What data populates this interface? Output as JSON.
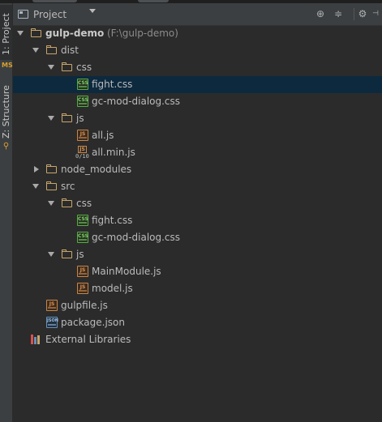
{
  "side_tabs": [
    {
      "label": "1: Project"
    },
    {
      "label": "Z: Structure"
    }
  ],
  "header": {
    "view_label": "Project",
    "buttons": [
      "target-icon",
      "collapse-icon",
      "gear-icon",
      "hide-icon"
    ]
  },
  "tree": [
    {
      "depth": 0,
      "type": "folder",
      "arrow": "down",
      "label": "gulp-demo",
      "hint": "(F:\\gulp-demo)",
      "bold": true
    },
    {
      "depth": 1,
      "type": "folder",
      "arrow": "down",
      "label": "dist"
    },
    {
      "depth": 2,
      "type": "folder",
      "arrow": "down",
      "label": "css"
    },
    {
      "depth": 3,
      "type": "css",
      "label": "fight.css",
      "selected": true
    },
    {
      "depth": 3,
      "type": "css",
      "label": "gc-mod-dialog.css"
    },
    {
      "depth": 2,
      "type": "folder",
      "arrow": "down",
      "label": "js"
    },
    {
      "depth": 3,
      "type": "js",
      "label": "all.js"
    },
    {
      "depth": 3,
      "type": "minjs",
      "label": "all.min.js"
    },
    {
      "depth": 1,
      "type": "folder",
      "arrow": "right",
      "label": "node_modules"
    },
    {
      "depth": 1,
      "type": "folder",
      "arrow": "down",
      "label": "src"
    },
    {
      "depth": 2,
      "type": "folder",
      "arrow": "down",
      "label": "css"
    },
    {
      "depth": 3,
      "type": "css",
      "label": "fight.css"
    },
    {
      "depth": 3,
      "type": "css",
      "label": "gc-mod-dialog.css"
    },
    {
      "depth": 2,
      "type": "folder",
      "arrow": "down",
      "label": "js"
    },
    {
      "depth": 3,
      "type": "js",
      "label": "MainModule.js"
    },
    {
      "depth": 3,
      "type": "js",
      "label": "model.js"
    },
    {
      "depth": 1,
      "type": "js",
      "label": "gulpfile.js"
    },
    {
      "depth": 1,
      "type": "json",
      "label": "package.json"
    },
    {
      "depth": 0,
      "type": "library",
      "label": "External Libraries"
    }
  ],
  "colors": {
    "background": "#2b2b2b",
    "selection": "#0d293e",
    "folder": "#c9a66b",
    "css": "#5aab4a",
    "js": "#c7864a"
  }
}
